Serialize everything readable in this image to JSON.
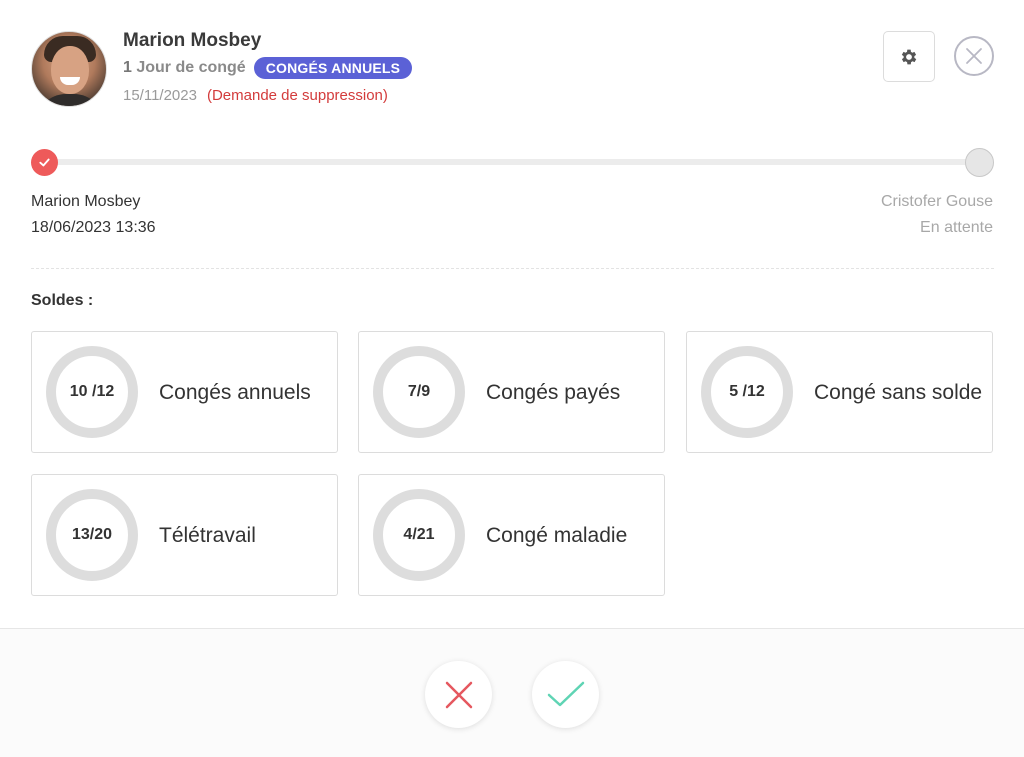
{
  "request": {
    "employee_name": "Marion Mosbey",
    "duration_number": "1",
    "duration_text": " Jour de congé",
    "leave_type_badge": "CONGÉS ANNUELS",
    "date": "15/11/2023",
    "deletion_note": "(Demande de suppression)"
  },
  "toolbar": {
    "settings_icon": "gear-icon",
    "close_icon": "close-circle-icon"
  },
  "workflow": {
    "steps": [
      {
        "name": "Marion Mosbey",
        "detail": "18/06/2023 13:36",
        "status": "approved"
      },
      {
        "name": "Cristofer Gouse",
        "detail": "En attente",
        "status": "pending"
      }
    ]
  },
  "balances": {
    "title": "Soldes :",
    "items": [
      {
        "label": "Congés annuels",
        "ratio": "10 /12",
        "used": 10,
        "total": 12,
        "color": "#5b61d6"
      },
      {
        "label": "Congés payés",
        "ratio": "7/9",
        "used": 7,
        "total": 9,
        "color": "#f25b65"
      },
      {
        "label": "Congé sans solde",
        "ratio": "5 /12",
        "used": 5,
        "total": 12,
        "color": "#1cc487"
      },
      {
        "label": "Télétravail",
        "ratio": "13/20",
        "used": 13,
        "total": 20,
        "color": "#b8228a"
      },
      {
        "label": "Congé maladie",
        "ratio": "4/21",
        "used": 4,
        "total": 21,
        "color": "#f5770e"
      }
    ]
  },
  "actions": {
    "reject_icon": "x-icon",
    "reject_color": "#e5575f",
    "approve_icon": "check-icon",
    "approve_color": "#5fd4b4"
  },
  "colors": {
    "accent": "#5b61d6",
    "danger": "#d33b3b",
    "track": "#dddddd"
  }
}
